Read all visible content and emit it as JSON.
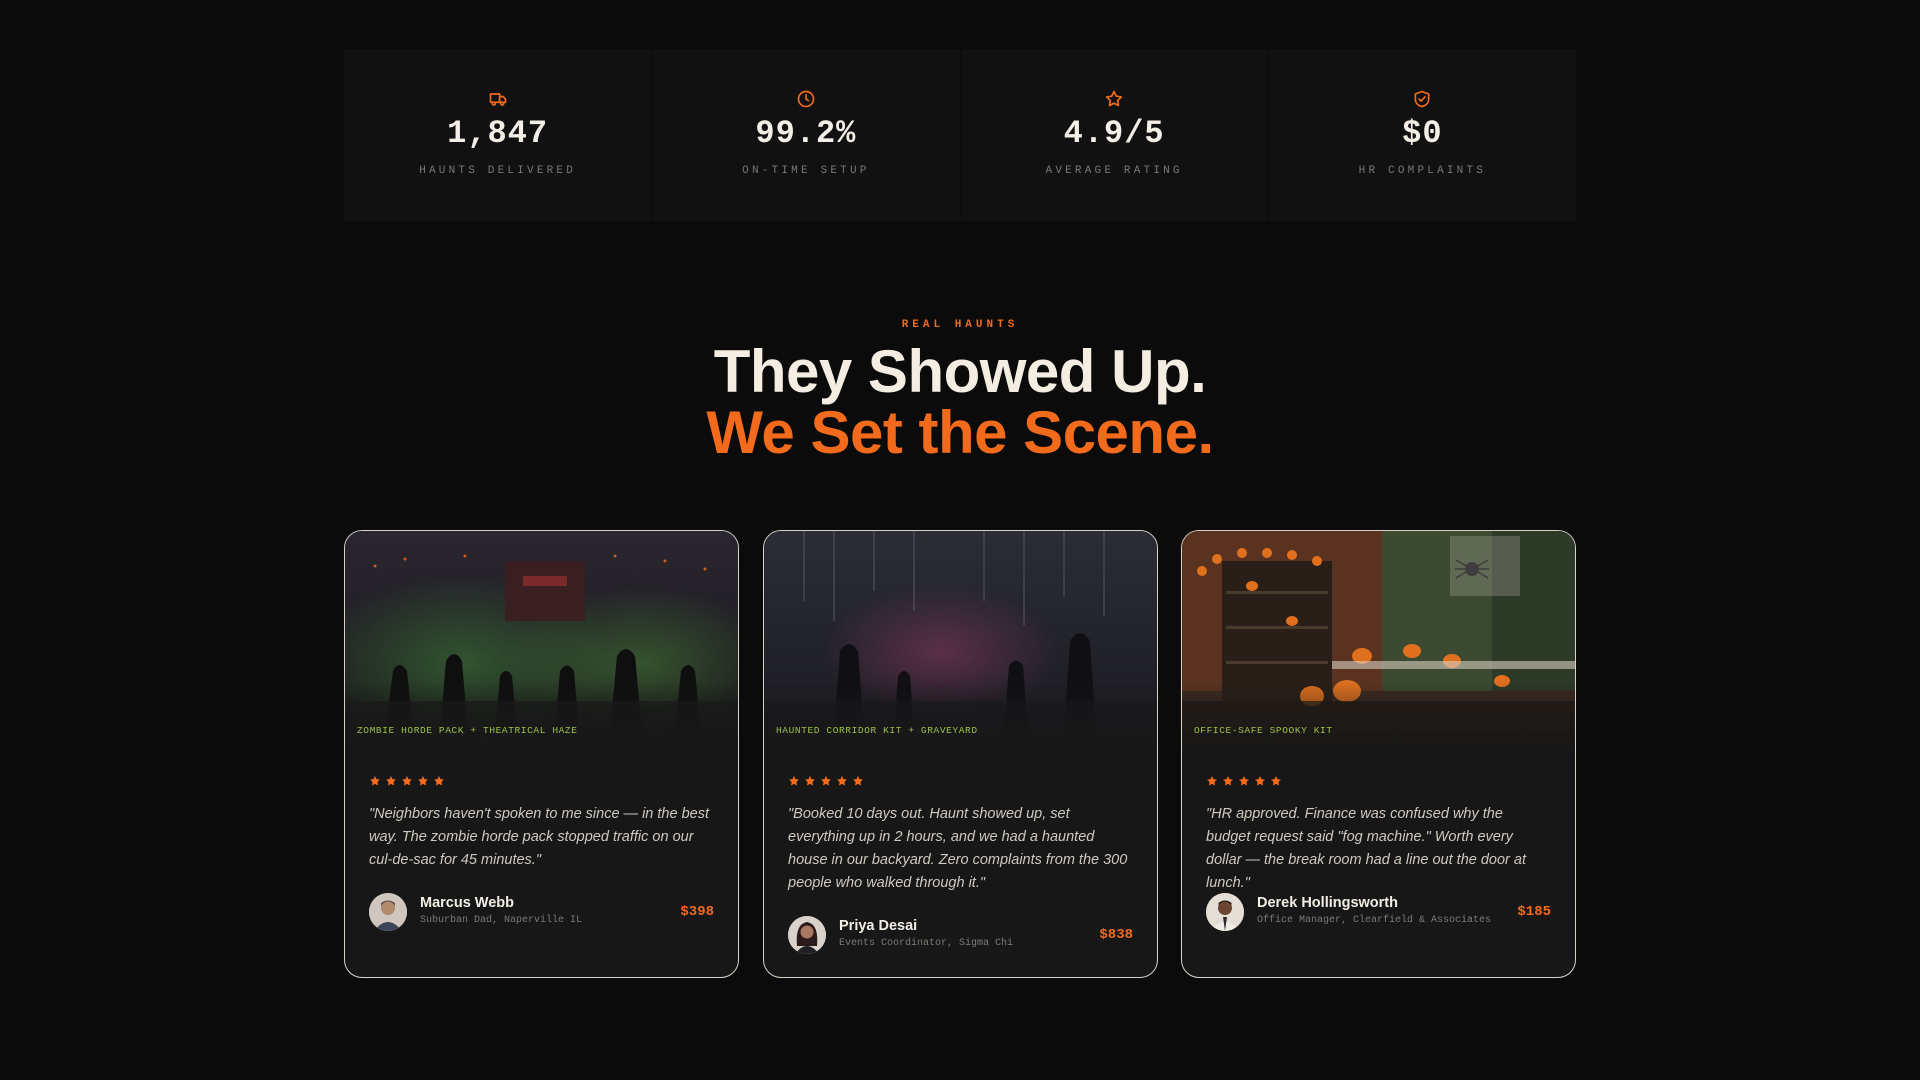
{
  "colors": {
    "background": "#0b0b0b",
    "panel": "#111111",
    "accent": "#f26a1b",
    "tag_green": "#9bc24a",
    "text_light": "#f3efe7"
  },
  "stats": [
    {
      "icon": "truck-icon",
      "value": "1,847",
      "label": "HAUNTS DELIVERED"
    },
    {
      "icon": "clock-icon",
      "value": "99.2%",
      "label": "ON-TIME SETUP"
    },
    {
      "icon": "star-icon",
      "value": "4.9/5",
      "label": "AVERAGE RATING"
    },
    {
      "icon": "shield-check-icon",
      "value": "$0",
      "label": "HR COMPLAINTS"
    }
  ],
  "section": {
    "eyebrow": "REAL HAUNTS",
    "title_line1": "They Showed Up.",
    "title_line2": "We Set the Scene."
  },
  "testimonials": [
    {
      "tag": "ZOMBIE HORDE PACK + THEATRICAL HAZE",
      "rating": 5,
      "quote": "\"Neighbors haven't spoken to me since — in the best way. The zombie horde pack stopped traffic on our cul-de-sac for 45 minutes.\"",
      "name": "Marcus Webb",
      "role": "Suburban Dad, Naperville IL",
      "price": "$398",
      "image": "zombie-horde-scene"
    },
    {
      "tag": "HAUNTED CORRIDOR KIT + GRAVEYARD",
      "rating": 5,
      "quote": "\"Booked 10 days out. Haunt showed up, set everything up in 2 hours, and we had a haunted house in our backyard. Zero complaints from the 300 people who walked through it.\"",
      "name": "Priya Desai",
      "role": "Events Coordinator, Sigma Chi",
      "price": "$838",
      "image": "haunted-corridor-scene"
    },
    {
      "tag": "OFFICE-SAFE SPOOKY KIT",
      "rating": 5,
      "quote": "\"HR approved. Finance was confused why the budget request said \"fog machine.\" Worth every dollar — the break room had a line out the door at lunch.\"",
      "name": "Derek Hollingsworth",
      "role": "Office Manager, Clearfield & Associates",
      "price": "$185",
      "image": "office-spooky-scene"
    }
  ]
}
